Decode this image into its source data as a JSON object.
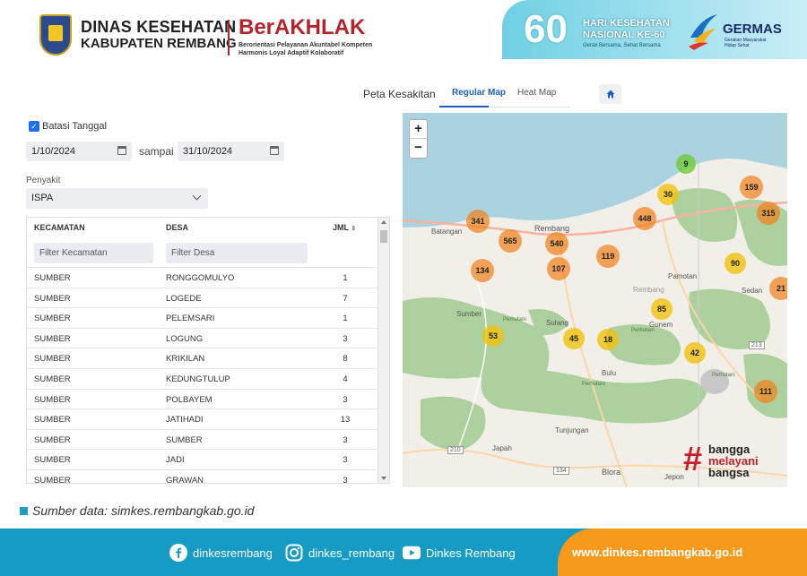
{
  "header": {
    "org_line1": "DINAS KESEHATAN",
    "org_line2": "KABUPATEN REMBANG",
    "berakhlak": "BerAKHLAK",
    "berakhlak_sub1": "Berorientasi Pelayanan Akuntabel Kompeten",
    "berakhlak_sub2": "Harmonis Loyal Adaptif Kolaboratif",
    "hkn_number": "60",
    "hkn_title1": "HARI KESEHATAN",
    "hkn_title2": "NASIONAL KE-60",
    "hkn_tagline": "Gerak Bersama, Sehat Bersama",
    "germas": "GERMAS",
    "germas_sub": "Gerakan Masyarakat Hidup Sehat"
  },
  "tabs": {
    "peta": "Peta Kesakitan",
    "regular": "Regular Map",
    "heat": "Heat Map"
  },
  "filters": {
    "batasi_label": "Batasi Tanggal",
    "date_from": "1/10/2024",
    "sampai": "sampai",
    "date_to": "31/10/2024",
    "penyakit_label": "Penyakit",
    "penyakit_value": "ISPA"
  },
  "table": {
    "headers": {
      "kecamatan": "KECAMATAN",
      "desa": "DESA",
      "jml": "JML"
    },
    "filter_kec_placeholder": "Filter Kecamatan",
    "filter_desa_placeholder": "Filter Desa",
    "rows": [
      {
        "kec": "SUMBER",
        "desa": "RONGGOMULYO",
        "jml": "1"
      },
      {
        "kec": "SUMBER",
        "desa": "LOGEDE",
        "jml": "7"
      },
      {
        "kec": "SUMBER",
        "desa": "PELEMSARI",
        "jml": "1"
      },
      {
        "kec": "SUMBER",
        "desa": "LOGUNG",
        "jml": "3"
      },
      {
        "kec": "SUMBER",
        "desa": "KRIKILAN",
        "jml": "8"
      },
      {
        "kec": "SUMBER",
        "desa": "KEDUNGTULUP",
        "jml": "4"
      },
      {
        "kec": "SUMBER",
        "desa": "POLBAYEM",
        "jml": "3"
      },
      {
        "kec": "SUMBER",
        "desa": "JATIHADI",
        "jml": "13"
      },
      {
        "kec": "SUMBER",
        "desa": "SUMBER",
        "jml": "3"
      },
      {
        "kec": "SUMBER",
        "desa": "JADI",
        "jml": "3"
      },
      {
        "kec": "SUMBER",
        "desa": "GRAWAN",
        "jml": "3"
      }
    ]
  },
  "map": {
    "zoom_in": "+",
    "zoom_out": "−",
    "clusters": [
      {
        "v": "341",
        "c": "orange"
      },
      {
        "v": "565",
        "c": "orange"
      },
      {
        "v": "540",
        "c": "orange"
      },
      {
        "v": "107",
        "c": "orange"
      },
      {
        "v": "134",
        "c": "orange"
      },
      {
        "v": "119",
        "c": "orange"
      },
      {
        "v": "448",
        "c": "orange"
      },
      {
        "v": "30",
        "c": "yellow"
      },
      {
        "v": "9",
        "c": "green"
      },
      {
        "v": "159",
        "c": "orange"
      },
      {
        "v": "315",
        "c": "orange"
      },
      {
        "v": "90",
        "c": "yellow"
      },
      {
        "v": "21",
        "c": "orange"
      },
      {
        "v": "85",
        "c": "yellow"
      },
      {
        "v": "53",
        "c": "yellow"
      },
      {
        "v": "45",
        "c": "yellow"
      },
      {
        "v": "18",
        "c": "yellow"
      },
      {
        "v": "42",
        "c": "yellow"
      },
      {
        "v": "111",
        "c": "orange"
      }
    ],
    "towns": [
      "Batangan",
      "Rembang",
      "Pamotan",
      "Sedan",
      "Rembang",
      "Sumber",
      "Sulang",
      "Gunem",
      "Bulu",
      "Tunjungan",
      "Japah",
      "Blora",
      "Jepon",
      "Perhutani",
      "Perhutani",
      "Perhutani",
      "Perhutani"
    ],
    "roads": [
      "210",
      "134",
      "213"
    ]
  },
  "bangga": {
    "line1": "bangga",
    "line2": "melayani",
    "line3": "bangsa"
  },
  "source": "Sumber data: simkes.rembangkab.go.id",
  "footer": {
    "facebook": "dinkesrembang",
    "instagram": "dinkes_rembang",
    "youtube": "Dinkes Rembang",
    "website": "www.dinkes.rembangkab.go.id"
  },
  "colors": {
    "accent": "#1d5fbf",
    "footer_blue": "#169bc4",
    "footer_orange": "#f79a1c",
    "brand_red": "#b8222a"
  }
}
